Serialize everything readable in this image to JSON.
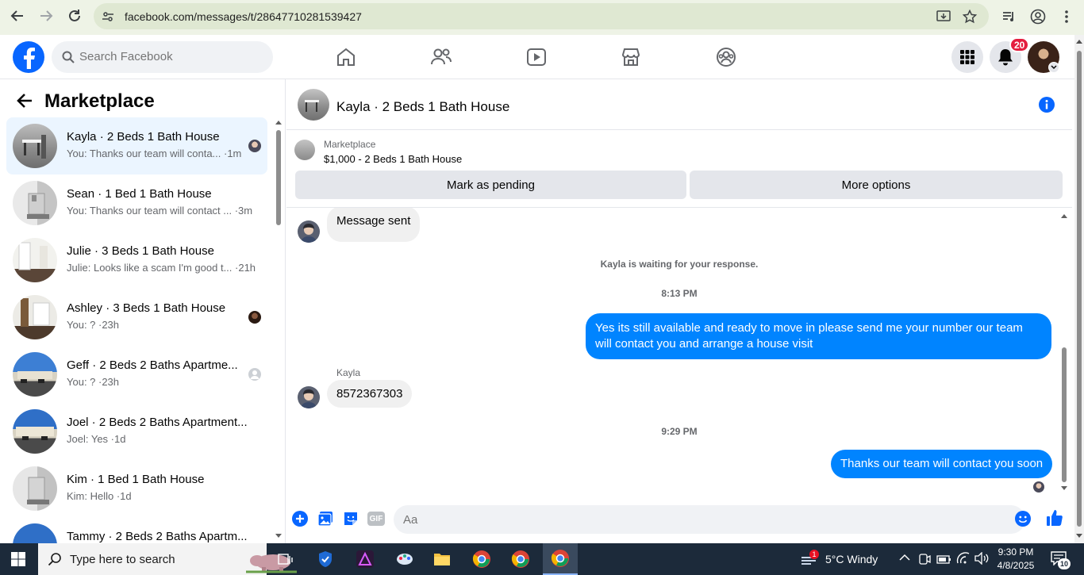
{
  "browser": {
    "url": "facebook.com/messages/t/28647710281539427"
  },
  "fb": {
    "search_placeholder": "Search Facebook",
    "notification_count": "20"
  },
  "sidebar": {
    "title": "Marketplace",
    "threads": [
      {
        "name": "Kayla · 2 Beds 1 Bath House",
        "preview": "You: Thanks our team will conta... ·1m",
        "active": true
      },
      {
        "name": "Sean · 1 Bed 1 Bath House",
        "preview": "You: Thanks our team will contact ... ·3m"
      },
      {
        "name": "Julie · 3 Beds 1 Bath House",
        "preview": "Julie: Looks like a scam I'm good t... ·21h"
      },
      {
        "name": "Ashley · 3 Beds 1 Bath House",
        "preview": "You: ? ·23h"
      },
      {
        "name": "Geff · 2 Beds 2 Baths Apartme...",
        "preview": "You: ? ·23h"
      },
      {
        "name": "Joel · 2 Beds 2 Baths Apartment...",
        "preview": "Joel: Yes ·1d"
      },
      {
        "name": "Kim · 1 Bed 1 Bath House",
        "preview": "Kim: Hello ·1d"
      },
      {
        "name": "Tammy · 2 Beds 2 Baths Apartm...",
        "preview": ""
      }
    ]
  },
  "conversation": {
    "title": "Kayla · 2 Beds 1 Bath House",
    "listing_category": "Marketplace",
    "listing_price": "$1,000 - 2 Beds 1 Bath House",
    "mark_pending_label": "Mark as pending",
    "more_options_label": "More options",
    "messages": {
      "m1": "Message sent",
      "waiting": "Kayla is waiting for your response.",
      "ts1": "8:13 PM",
      "m2": "Yes its still available and ready to move in please send me your number our team will contact you and arrange a  house visit",
      "sender_name": "Kayla",
      "m3": "8572367303",
      "ts2": "9:29 PM",
      "m4": "Thanks our team will contact you soon"
    },
    "composer_placeholder": "Aa",
    "gif_label": "GIF"
  },
  "taskbar": {
    "search_placeholder": "Type here to search",
    "weather": "5°C  Windy",
    "weather_alert": "1",
    "time": "9:30 PM",
    "date": "4/8/2025",
    "notification_count": "10"
  },
  "colors": {
    "fb_blue": "#0866ff",
    "bubble_out": "#0084ff",
    "active_thread": "#ebf5ff"
  }
}
